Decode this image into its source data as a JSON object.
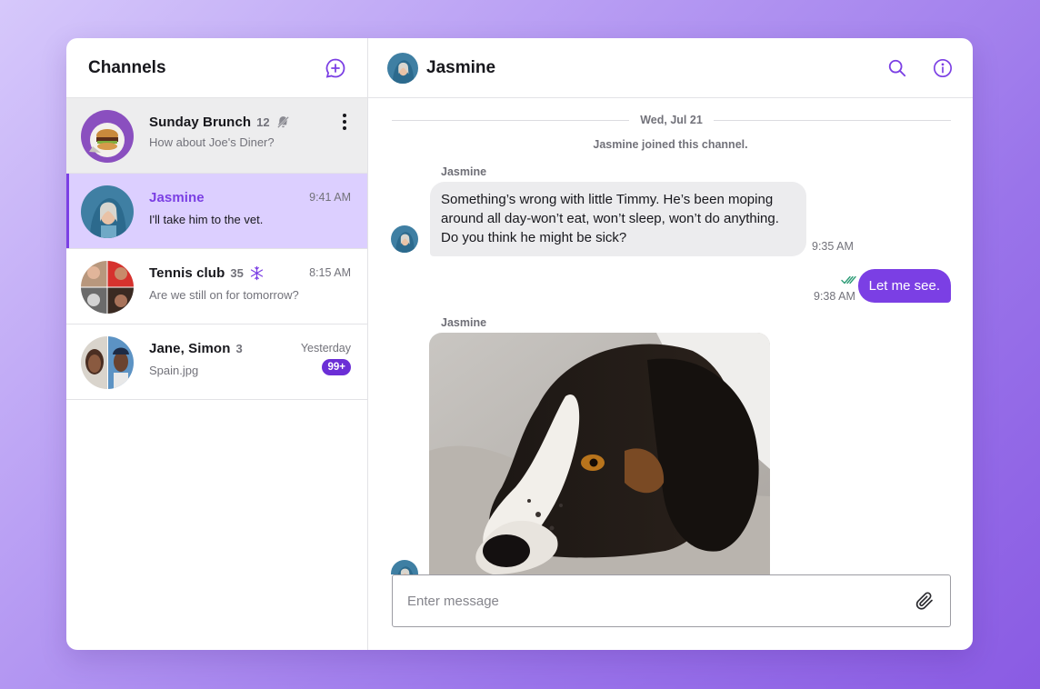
{
  "sidebar": {
    "title": "Channels",
    "new_chat_icon": "chat-plus-icon",
    "channels": [
      {
        "name": "Sunday Brunch",
        "count": "12",
        "preview": "How about Joe's Diner?",
        "time": "",
        "status_icon": "bell-muted-icon"
      },
      {
        "name": "Jasmine",
        "count": "",
        "preview": "I'll take him to the vet.",
        "time": "9:41 AM"
      },
      {
        "name": "Tennis club",
        "count": "35",
        "preview": "Are we still on for tomorrow?",
        "time": "8:15 AM",
        "status_icon": "snowflake-icon"
      },
      {
        "name": "Jane, Simon",
        "count": "3",
        "preview": "Spain.jpg",
        "time": "Yesterday",
        "unread": "99+"
      }
    ]
  },
  "header": {
    "name": "Jasmine",
    "icons": [
      "search-icon",
      "info-icon"
    ]
  },
  "messages": {
    "date_separator": "Wed, Jul 21",
    "system": "Jasmine joined this channel.",
    "incoming_1": {
      "sender": "Jasmine",
      "text": "Something’s wrong with little Timmy. He’s been moping around all day-won’t eat, won’t sleep, won’t do anything. Do you think he might be sick?",
      "time": "9:35 AM"
    },
    "outgoing_1": {
      "text": "Let me see.",
      "time": "9:38 AM"
    },
    "incoming_2": {
      "sender": "Jasmine"
    }
  },
  "composer": {
    "placeholder": "Enter message"
  },
  "colors": {
    "accent": "#7b3fe4",
    "active_row": "#dccfff",
    "read_check": "#2e9c77",
    "badge": "#6b2ed6"
  }
}
